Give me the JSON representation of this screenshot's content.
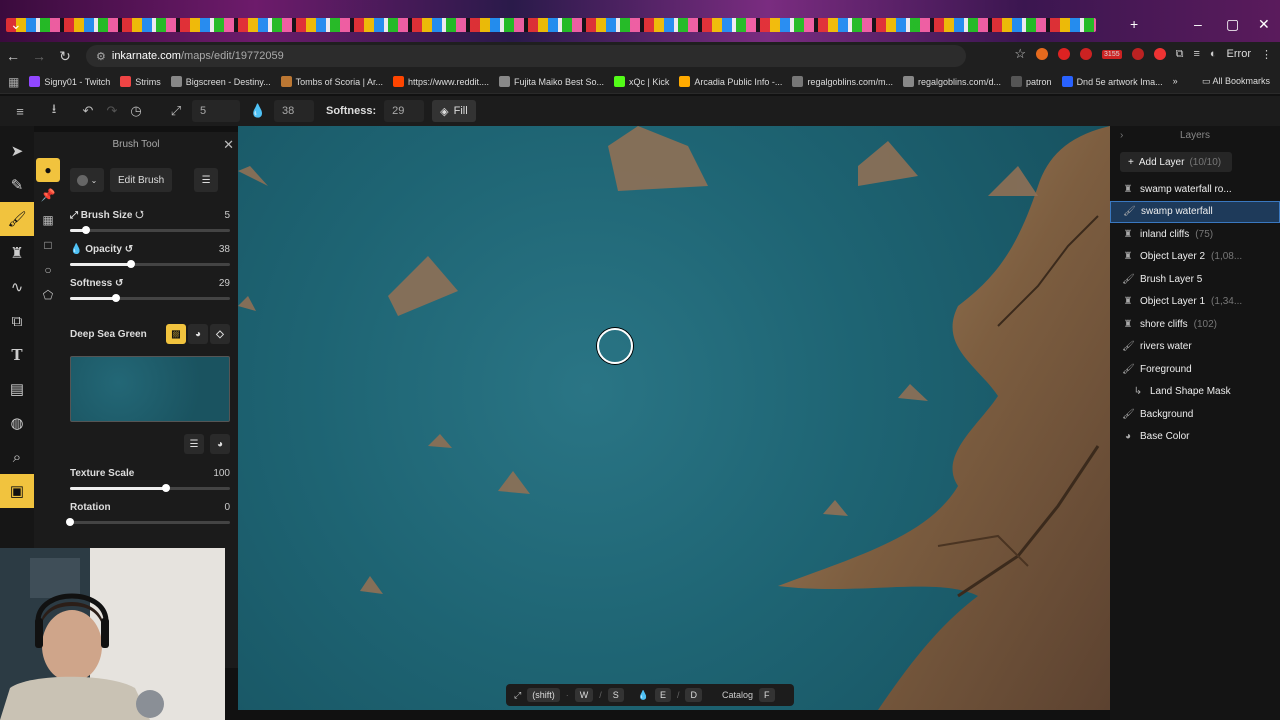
{
  "browser": {
    "url_site": "inkarnate.com",
    "url_path": "/maps/edit/19772059",
    "error_label": "Error",
    "bookmarks": [
      {
        "label": "Signy01 - Twitch",
        "color": "#9147ff"
      },
      {
        "label": "Strims",
        "color": "#e44"
      },
      {
        "label": "Bigscreen - Destiny...",
        "color": "#888"
      },
      {
        "label": "Tombs of Scoria | Ar...",
        "color": "#b73"
      },
      {
        "label": "https://www.reddit....",
        "color": "#ff4500"
      },
      {
        "label": "Fujita Maiko Best So...",
        "color": "#888"
      },
      {
        "label": "xQc | Kick",
        "color": "#53fc18"
      },
      {
        "label": "Arcadia Public Info -...",
        "color": "#fa0"
      },
      {
        "label": "regalgoblins.com/m...",
        "color": "#777"
      },
      {
        "label": "regalgoblins.com/d...",
        "color": "#888"
      },
      {
        "label": "patron",
        "color": "#555"
      },
      {
        "label": "Dnd 5e artwork Ima...",
        "color": "#2962ff"
      }
    ],
    "all_bookmarks": "All Bookmarks",
    "badge_count": "3155"
  },
  "toolbar": {
    "size_value": "5",
    "opacity_value": "38",
    "softness_label": "Softness:",
    "softness_value": "29",
    "fill_label": "Fill"
  },
  "brush_panel": {
    "title": "Brush Tool",
    "edit_brush": "Edit Brush",
    "brush_size_label": "Brush Size",
    "brush_size_value": "5",
    "brush_size_frac": 0.1,
    "opacity_label": "Opacity",
    "opacity_value": "38",
    "opacity_frac": 0.38,
    "softness_label": "Softness",
    "softness_value": "29",
    "softness_frac": 0.29,
    "texture_name": "Deep Sea Green",
    "texture_color": "#1f6070",
    "texture_scale_label": "Texture Scale",
    "texture_scale_value": "100",
    "texture_scale_frac": 0.6,
    "rotation_label": "Rotation",
    "rotation_value": "0",
    "rotation_frac": 0.0
  },
  "bottombar": {
    "shift_key": "(shift)",
    "key_w": "W",
    "key_s": "S",
    "key_e": "E",
    "key_d": "D",
    "catalog_label": "Catalog",
    "key_f": "F"
  },
  "layers": {
    "title": "Layers",
    "add_label": "Add Layer",
    "add_count": "(10/10)",
    "items": [
      {
        "label": "swamp waterfall ro...",
        "sub": "",
        "icon": "object-icon"
      },
      {
        "label": "swamp waterfall",
        "sub": "",
        "icon": "brush-icon",
        "selected": true
      },
      {
        "label": "inland cliffs",
        "sub": "(75)",
        "icon": "object-icon"
      },
      {
        "label": "Object Layer 2",
        "sub": "(1,08...",
        "icon": "object-icon"
      },
      {
        "label": "Brush Layer 5",
        "sub": "",
        "icon": "brush-icon"
      },
      {
        "label": "Object Layer 1",
        "sub": "(1,34...",
        "icon": "object-icon"
      },
      {
        "label": "shore cliffs",
        "sub": "(102)",
        "icon": "object-icon"
      },
      {
        "label": "rivers water",
        "sub": "",
        "icon": "brush-icon"
      },
      {
        "label": "Foreground",
        "sub": "",
        "icon": "brush-icon"
      },
      {
        "label": "Land Shape Mask",
        "sub": "",
        "icon": "mask-icon",
        "indent": true
      },
      {
        "label": "Background",
        "sub": "",
        "icon": "brush-icon"
      },
      {
        "label": "Base Color",
        "sub": "",
        "icon": "palette-icon"
      }
    ]
  },
  "colors": {
    "accent": "#f1c33e",
    "water": "#1e6473",
    "land": "#8a6a48",
    "selection": "#3a78c0"
  }
}
